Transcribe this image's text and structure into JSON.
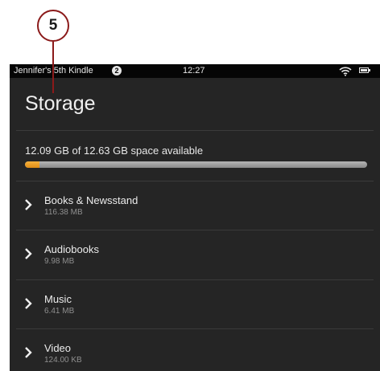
{
  "callout": {
    "number": "5"
  },
  "status_bar": {
    "device_name": "Jennifer's 5th Kindle",
    "notification_count": "2",
    "time": "12:27"
  },
  "page": {
    "title": "Storage"
  },
  "storage": {
    "space_text": "12.09 GB of 12.63 GB space available",
    "used_fraction": 0.043
  },
  "categories": [
    {
      "label": "Books & Newsstand",
      "size": "116.38 MB"
    },
    {
      "label": "Audiobooks",
      "size": "9.98 MB"
    },
    {
      "label": "Music",
      "size": "6.41 MB"
    },
    {
      "label": "Video",
      "size": "124.00 KB"
    }
  ],
  "colors": {
    "background": "#252525",
    "status_bar": "#050505",
    "progress_fill": "#f0a02a",
    "progress_track": "#9e9e9e",
    "callout_border": "#8b1a1a"
  }
}
